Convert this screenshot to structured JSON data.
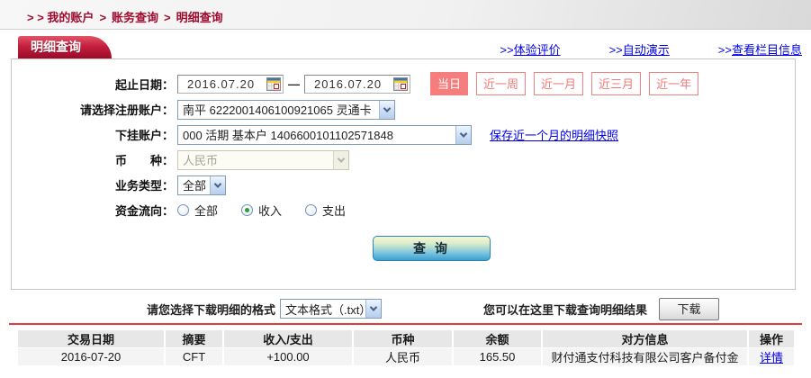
{
  "colors": {
    "brand_red": "#9e0b2e",
    "tab_red": "#c51f3f",
    "quick_button_salmon": "#f57d7d",
    "link_blue": "#0000ee",
    "amount_red": "#cc0000",
    "divider_red": "#e23d3d"
  },
  "breadcrumb": {
    "prefix": "> >",
    "separator": ">",
    "items": [
      "我的账户",
      "账务查询",
      "明细查询"
    ]
  },
  "tab_title": "明细查询",
  "top_links": [
    {
      "prefix": ">>",
      "label": "体验评价"
    },
    {
      "prefix": ">>",
      "label": "自动演示"
    },
    {
      "prefix": ">>",
      "label": "查看栏目信息"
    }
  ],
  "form": {
    "date": {
      "label": "起止日期：",
      "start": "2016.07.20",
      "end": "2016.07.20",
      "separator": "—"
    },
    "quick_ranges": [
      {
        "label": "当日",
        "active": true
      },
      {
        "label": "近一周",
        "active": false
      },
      {
        "label": "近一月",
        "active": false
      },
      {
        "label": "近三月",
        "active": false
      },
      {
        "label": "近一年",
        "active": false
      }
    ],
    "registered_account": {
      "label": "请选择注册账户：",
      "value": "南平 6222001406100921065 灵通卡"
    },
    "sub_account": {
      "label": "下挂账户：",
      "value": "000 活期 基本户 1406600101102571848",
      "snapshot_link": "保存近一个月的明细快照"
    },
    "currency": {
      "label": "币　　种：",
      "value": "人民币",
      "disabled": true
    },
    "business_type": {
      "label": "业务类型：",
      "value": "全部"
    },
    "fund_flow": {
      "label": "资金流向：",
      "options": [
        {
          "label": "全部",
          "checked": false
        },
        {
          "label": "收入",
          "checked": true
        },
        {
          "label": "支出",
          "checked": false
        }
      ]
    },
    "query_button": "查 询"
  },
  "download": {
    "format_label": "请您选择下载明细的格式",
    "format_value": "文本格式（.txt）",
    "result_hint": "您可以在这里下载查询明细结果",
    "button_label": "下载"
  },
  "table": {
    "headers": [
      "交易日期",
      "摘要",
      "收入/支出",
      "币种",
      "余额",
      "对方信息",
      "操作"
    ],
    "rows": [
      {
        "date": "2016-07-20",
        "summary": "CFT",
        "amount": "+100.00",
        "currency": "人民币",
        "balance": "165.50",
        "counterparty": "财付通支付科技有限公司客户备付金",
        "action": "详情"
      }
    ]
  }
}
